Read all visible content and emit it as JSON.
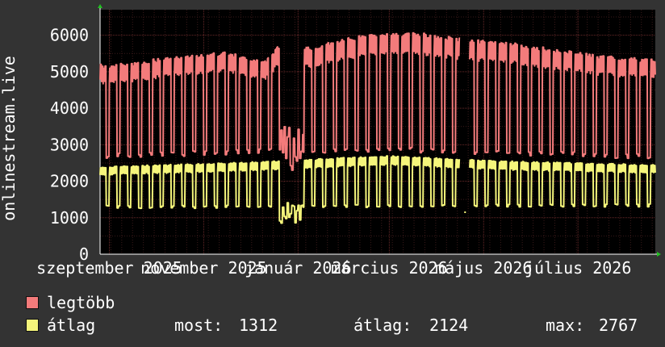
{
  "chart_data": {
    "type": "line",
    "ylabel": "onlinestream.live",
    "ylim": [
      0,
      6700
    ],
    "yticks": [
      0,
      1000,
      2000,
      3000,
      4000,
      5000,
      6000
    ],
    "ytick_labels": [
      "0",
      "1000",
      "2000",
      "3000",
      "4000",
      "5000",
      "6000"
    ],
    "x_start": "2025-08-26",
    "x_end": "2026-08-20",
    "xticks": [
      {
        "date": "2025-09-01",
        "label": "szeptember 2025"
      },
      {
        "date": "2025-11-01",
        "label": "november 2025"
      },
      {
        "date": "2026-01-01",
        "label": "január 2026"
      },
      {
        "date": "2026-03-01",
        "label": "március 2026"
      },
      {
        "date": "2026-05-01",
        "label": "május 2026"
      },
      {
        "date": "2026-07-01",
        "label": "július 2026"
      }
    ],
    "grid": true,
    "series": [
      {
        "name": "legtöbb",
        "color": "#f37b7b",
        "weekday_peaks": [
          {
            "date": "2025-08-26",
            "value": 5200
          },
          {
            "date": "2025-09-15",
            "value": 5250
          },
          {
            "date": "2025-10-15",
            "value": 5450
          },
          {
            "date": "2025-11-15",
            "value": 5550
          },
          {
            "date": "2025-12-10",
            "value": 5300
          },
          {
            "date": "2025-12-19",
            "value": 5700
          },
          {
            "date": "2026-01-10",
            "value": 5700
          },
          {
            "date": "2026-02-10",
            "value": 6000
          },
          {
            "date": "2026-03-15",
            "value": 6100
          },
          {
            "date": "2026-04-20",
            "value": 5900
          },
          {
            "date": "2026-05-20",
            "value": 5800
          },
          {
            "date": "2026-06-20",
            "value": 5600
          },
          {
            "date": "2026-07-15",
            "value": 5450
          },
          {
            "date": "2026-08-20",
            "value": 5350
          }
        ],
        "weekend_lows": [
          {
            "date": "2025-08-26",
            "value": 2600
          },
          {
            "date": "2025-12-15",
            "value": 2750
          },
          {
            "date": "2026-03-01",
            "value": 2800
          },
          {
            "date": "2026-08-20",
            "value": 2600
          }
        ]
      },
      {
        "name": "átlag",
        "color": "#f5f57b",
        "weekday_peaks": [
          {
            "date": "2025-08-26",
            "value": 2400
          },
          {
            "date": "2025-11-15",
            "value": 2500
          },
          {
            "date": "2026-03-01",
            "value": 2700
          },
          {
            "date": "2026-05-15",
            "value": 2550
          },
          {
            "date": "2026-08-20",
            "value": 2450
          }
        ],
        "weekend_lows": [
          {
            "date": "2025-08-26",
            "value": 1250
          },
          {
            "date": "2026-08-20",
            "value": 1300
          }
        ]
      }
    ],
    "holiday_dip": {
      "start": "2025-12-20",
      "end": "2026-01-04",
      "max_low": 2300,
      "max_high": 3500,
      "avg_low": 850,
      "avg_high": 1450
    },
    "gaps": [
      {
        "start": "2026-04-16",
        "end": "2026-04-22",
        "avg_point": 1150
      }
    ]
  },
  "legend": [
    {
      "name": "legtöbb",
      "color": "#f37b7b"
    },
    {
      "name": "átlag",
      "color": "#f5f57b"
    }
  ],
  "stats": [
    {
      "label": "most:",
      "value": "1312"
    },
    {
      "label": "átlag:",
      "value": "2124"
    },
    {
      "label": "max:",
      "value": "2767"
    }
  ]
}
